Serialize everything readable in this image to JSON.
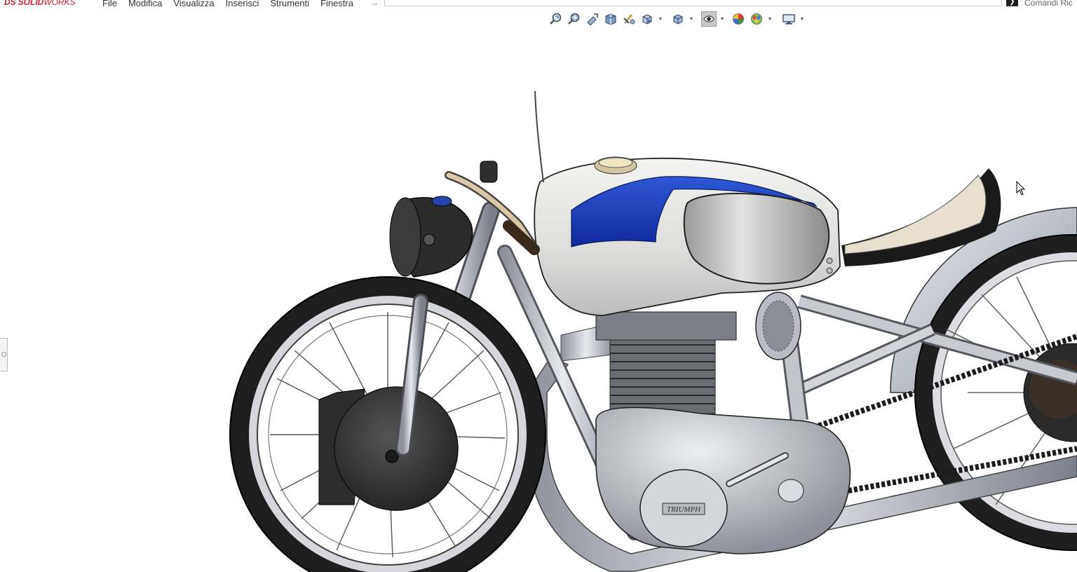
{
  "app": {
    "logo_mark": "DS",
    "logo_solid": "SOLID",
    "logo_works": "WORKS",
    "brand_color": "#d3212f"
  },
  "menu": {
    "items": [
      "File",
      "Modifica",
      "Visualizza",
      "Inserisci",
      "Strumenti",
      "Finestra"
    ]
  },
  "search": {
    "command_label": "Comandi Ric"
  },
  "view_toolbar": {
    "icons": [
      "zoom-to-fit-icon",
      "zoom-to-area-icon",
      "previous-view-icon",
      "section-view-icon",
      "dynamic-annotation-icon",
      "view-orientation-icon",
      "display-style-icon",
      "hide-show-items-icon",
      "edit-appearance-icon",
      "apply-scene-icon",
      "view-settings-icon"
    ],
    "active": "hide-show-items-icon"
  },
  "model": {
    "tank_accent_color": "#1a3fb8",
    "tank_color": "#e4e4e2",
    "tire_color": "#1e1e1e"
  }
}
